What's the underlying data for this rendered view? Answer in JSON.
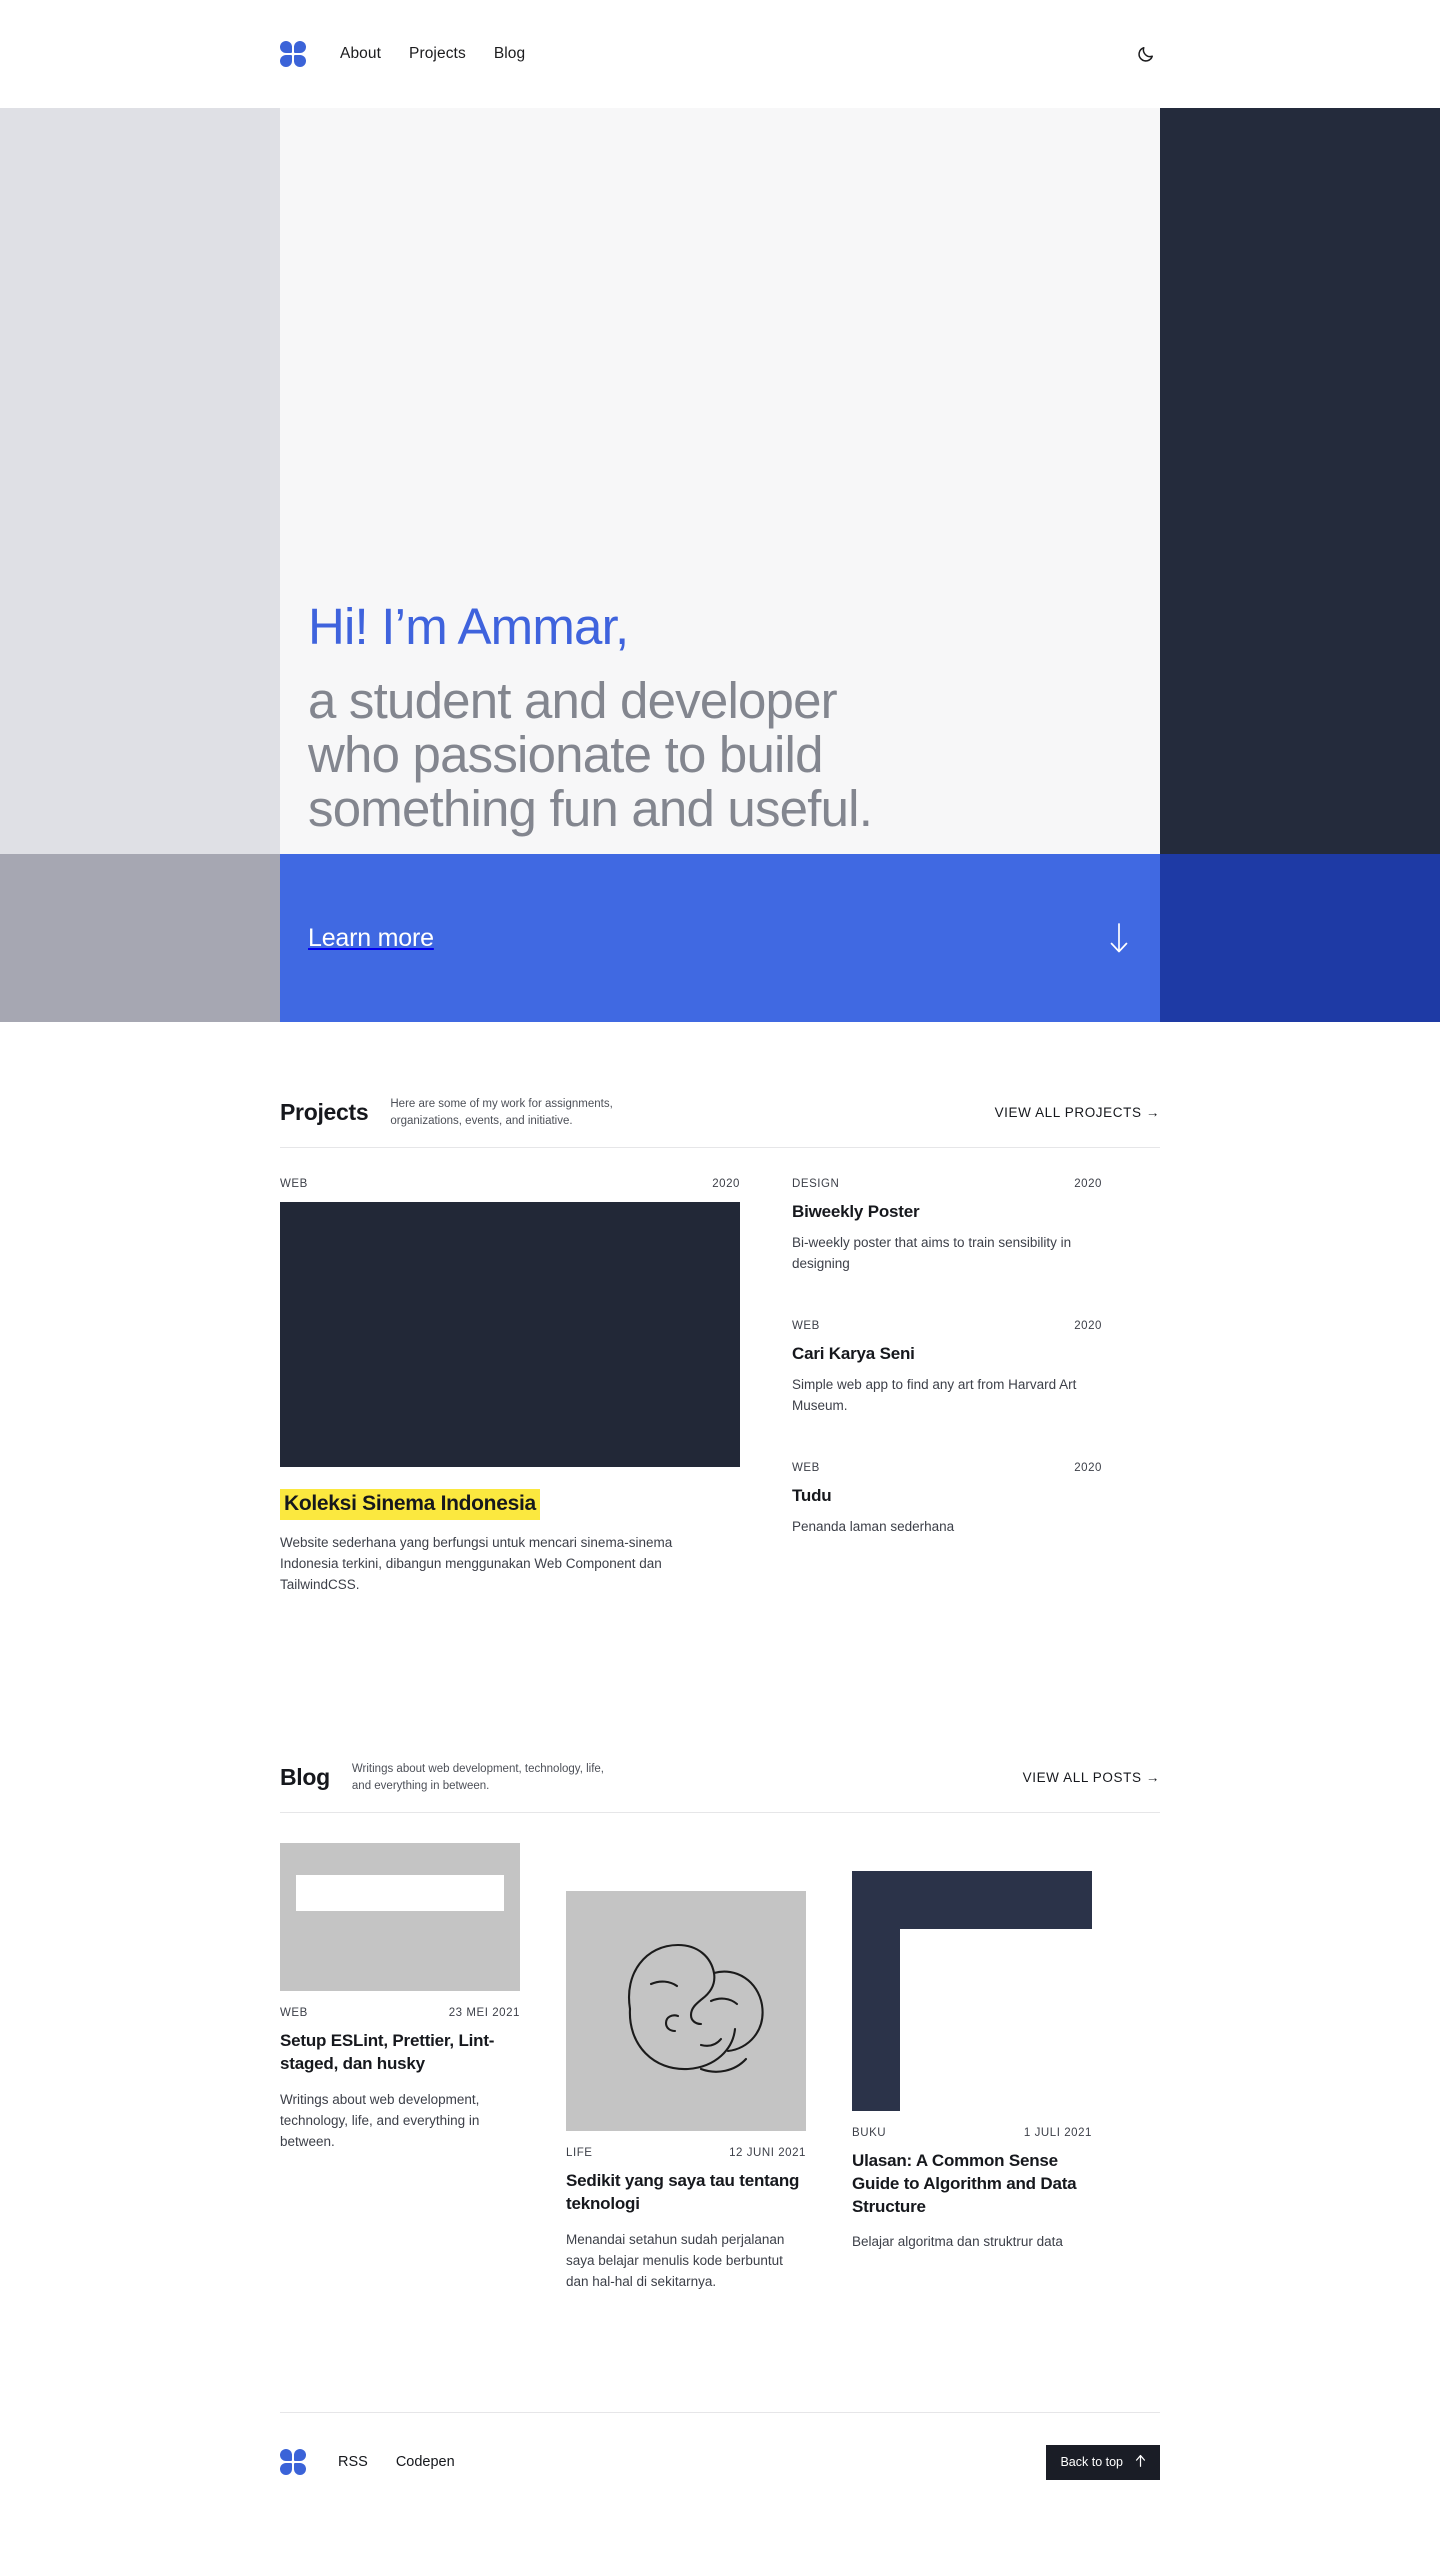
{
  "brand": {
    "logo_icon": "clover-logo-icon",
    "accent_blue": "#3f63dd",
    "band_blue": "#4069e2",
    "band_blue_dark": "#1e3aa5",
    "band_navy": "#242b3c",
    "highlight_yellow": "#fbe83f"
  },
  "nav": {
    "links": [
      {
        "label": "About"
      },
      {
        "label": "Projects"
      },
      {
        "label": "Blog"
      }
    ],
    "theme_toggle_icon": "moon-icon"
  },
  "hero": {
    "lines": [
      "Hi! I’m Ammar,",
      "a student and developer",
      "who passionate to build",
      "something fun and useful."
    ],
    "cta": {
      "label": "Learn more",
      "icon": "arrow-down-icon"
    }
  },
  "projects": {
    "title": "Projects",
    "subtitle": "Here are some of my work for assignments, organizations, events, and initiative.",
    "view_all": "VIEW ALL PROJECTS →",
    "featured": {
      "category": "WEB",
      "year": "2020",
      "title": "Koleksi Sinema Indonesia",
      "description": "Website sederhana yang berfungsi untuk mencari sinema-sinema Indonesia terkini, dibangun menggunakan Web Component dan TailwindCSS."
    },
    "items": [
      {
        "category": "DESIGN",
        "year": "2020",
        "title": "Biweekly Poster",
        "description": "Bi-weekly poster that aims to train sensibility in designing"
      },
      {
        "category": "WEB",
        "year": "2020",
        "title": "Cari Karya Seni",
        "description": "Simple web app to find any art from Harvard Art Museum."
      },
      {
        "category": "WEB",
        "year": "2020",
        "title": "Tudu",
        "description": "Penanda laman sederhana"
      }
    ]
  },
  "blog": {
    "title": "Blog",
    "subtitle": "Writings about web development, technology, life, and everything in between.",
    "view_all": "VIEW ALL POSTS →",
    "posts": [
      {
        "category": "WEB",
        "date": "23 MEI 2021",
        "title": "Setup ESLint, Prettier, Lint-staged, dan husky",
        "description": "Writings about web development, technology, life, and everything in between.",
        "thumb": "placeholder-bar-graphic"
      },
      {
        "category": "LIFE",
        "date": "12 JUNI 2021",
        "title": "Sedikit yang saya tau tentang teknologi",
        "description": "Menandai setahun sudah perjalanan saya belajar menulis kode berbuntut dan hal-hal di sekitarnya.",
        "thumb": "line-drawing-faces-graphic"
      },
      {
        "category": "BUKU",
        "date": "1 JULI 2021",
        "title": "Ulasan: A Common Sense Guide to Algorithm and Data Structure",
        "description": "Belajar algoritma dan struktrur data",
        "thumb": "navy-l-shape-graphic"
      }
    ]
  },
  "footer": {
    "links": [
      {
        "label": "RSS"
      },
      {
        "label": "Codepen"
      }
    ],
    "back_to_top": "Back to top",
    "back_to_top_icon": "arrow-up-icon"
  }
}
